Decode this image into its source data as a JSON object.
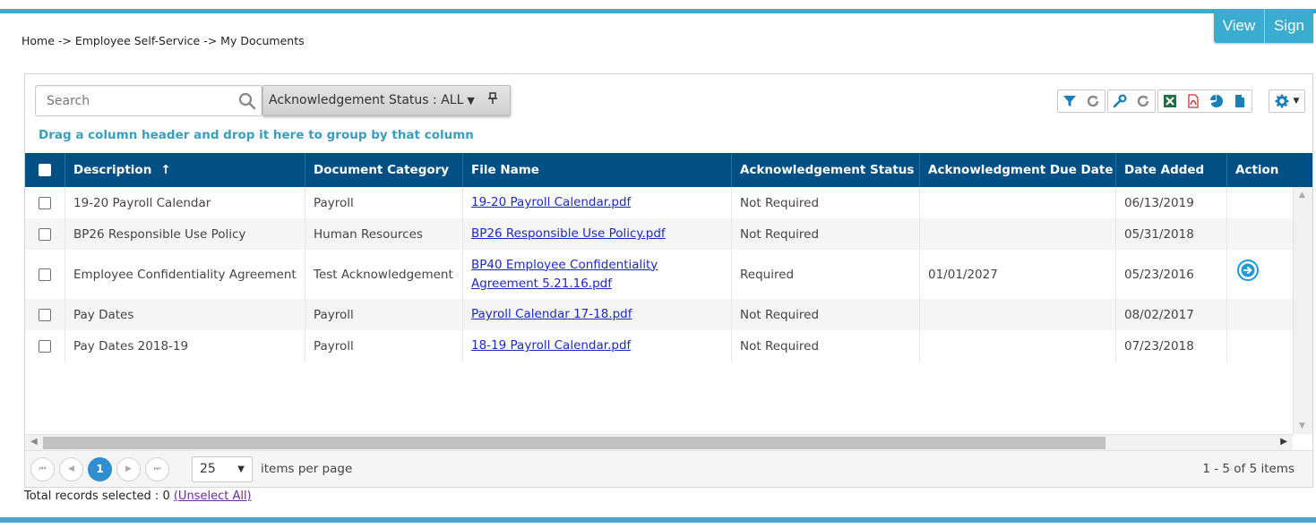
{
  "header": {
    "view_label": "View",
    "sign_label": "Sign",
    "accent_color": "#3aaccf"
  },
  "breadcrumb": "Home -> Employee Self-Service -> My Documents",
  "search": {
    "placeholder": "Search",
    "value": ""
  },
  "filter": {
    "label": "Acknowledgement Status : ALL"
  },
  "toolbar_icons": [
    "filter-icon",
    "refresh-icon",
    "wrench-icon",
    "refresh-icon",
    "excel-icon",
    "pdf-icon",
    "chart-icon",
    "document-icon",
    "gear-icon"
  ],
  "group_hint": "Drag a column header and drop it here to group by that column",
  "table": {
    "header_color": "#004f85",
    "columns": [
      "Description",
      "Document Category",
      "File Name",
      "Acknowledgement Status",
      "Acknowledgment Due Date",
      "Date Added",
      "Action"
    ],
    "sort_indicator": "↑",
    "rows": [
      {
        "description": "19-20 Payroll Calendar",
        "category": "Payroll",
        "file": "19-20 Payroll Calendar.pdf",
        "status": "Not Required",
        "due": "",
        "added": "06/13/2019",
        "action": ""
      },
      {
        "description": "BP26 Responsible Use Policy",
        "category": "Human Resources",
        "file": "BP26 Responsible Use Policy.pdf",
        "status": "Not Required",
        "due": "",
        "added": "05/31/2018",
        "action": ""
      },
      {
        "description": "Employee Confidentiality Agreement",
        "category": "Test Acknowledgement",
        "file": "BP40 Employee Confidentiality Agreement 5.21.16.pdf",
        "status": "Required",
        "due": "01/01/2027",
        "added": "05/23/2016",
        "action": "arrow-right-circle-icon"
      },
      {
        "description": "Pay Dates",
        "category": "Payroll",
        "file": "Payroll Calendar 17-18.pdf",
        "status": "Not Required",
        "due": "",
        "added": "08/02/2017",
        "action": ""
      },
      {
        "description": "Pay Dates 2018-19",
        "category": "Payroll",
        "file": "18-19 Payroll Calendar.pdf",
        "status": "Not Required",
        "due": "",
        "added": "07/23/2018",
        "action": ""
      }
    ]
  },
  "pager": {
    "current_page": "1",
    "page_size": "25",
    "page_size_label": "items per page",
    "info": "1 - 5 of 5 items"
  },
  "records": {
    "text": "Total records selected : 0",
    "unselect_label": "(Unselect All)"
  }
}
